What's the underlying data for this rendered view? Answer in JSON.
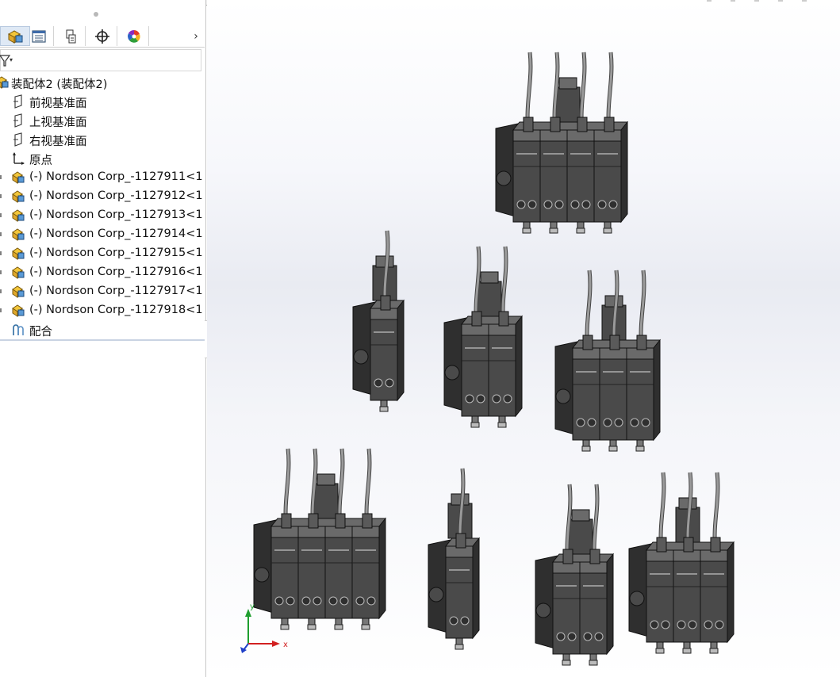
{
  "feature_tree": {
    "tabs": [
      {
        "name": "featuremanager-tab",
        "icon": "assembly-icon",
        "active": true
      },
      {
        "name": "propertymanager-tab",
        "icon": "property-list-icon",
        "active": false
      },
      {
        "name": "configurationmanager-tab",
        "icon": "configuration-icon",
        "active": false
      },
      {
        "name": "dimxpert-tab",
        "icon": "crosshair-icon",
        "active": false
      },
      {
        "name": "display-manager-tab",
        "icon": "color-wheel-icon",
        "active": false
      }
    ],
    "more_tabs_glyph": "›",
    "filter_arrow": "▾",
    "root": "装配体2  (装配体2)",
    "planes": [
      "前视基准面",
      "上视基准面",
      "右视基准面"
    ],
    "origin": "原点",
    "components": [
      "(-) Nordson Corp_-1127911<1",
      "(-) Nordson Corp_-1127912<1",
      "(-) Nordson Corp_-1127913<1",
      "(-) Nordson Corp_-1127914<1",
      "(-) Nordson Corp_-1127915<1",
      "(-) Nordson Corp_-1127916<1",
      "(-) Nordson Corp_-1127917<1",
      "(-) Nordson Corp_-1127918<1"
    ],
    "mates": "配合"
  },
  "triad": {
    "x_label": "x",
    "y_label": "y"
  },
  "colors": {
    "body": "#4a4a4a",
    "body_dark": "#2f2f2f",
    "body_light": "#6a6a6a",
    "cable": "#9a9a9a",
    "triad_x": "#d22020",
    "triad_y": "#1f9e2f",
    "triad_z": "#2040c8"
  }
}
